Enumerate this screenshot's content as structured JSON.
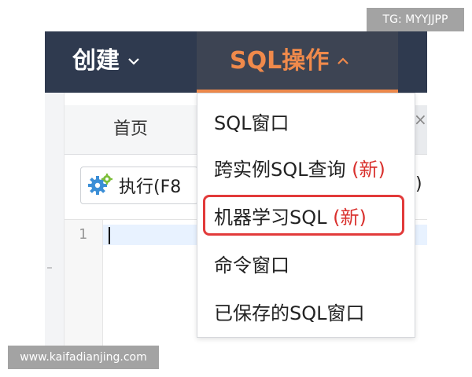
{
  "watermark": {
    "top": "TG: MYYJJPP",
    "bottom": "www.kaifadianjing.com"
  },
  "nav": {
    "create_label": "创建",
    "sql_ops_label": "SQL操作"
  },
  "editor": {
    "home_tab_label": "首页",
    "tab_close": "×",
    "run_button_label": "执行(F8",
    "toolbar_trailing": ")",
    "line_number": "1"
  },
  "dropdown": {
    "items": [
      {
        "label": "SQL窗口",
        "badge": ""
      },
      {
        "label": "跨实例SQL查询",
        "badge": "(新)"
      },
      {
        "label": "机器学习SQL",
        "badge": "(新)"
      },
      {
        "label": "命令窗口",
        "badge": ""
      },
      {
        "label": "已保存的SQL窗口",
        "badge": ""
      }
    ],
    "highlighted_index": 2
  },
  "colors": {
    "navbar_bg": "#2f3a4f",
    "active_tab_bg": "#3d4453",
    "accent_orange": "#f08a4b",
    "new_badge_red": "#d9302d",
    "highlight_red": "#e23a3a"
  },
  "icons": {
    "create_chevron": "chevron-down-icon",
    "sql_chevron": "chevron-up-icon",
    "run": "gears-icon"
  }
}
